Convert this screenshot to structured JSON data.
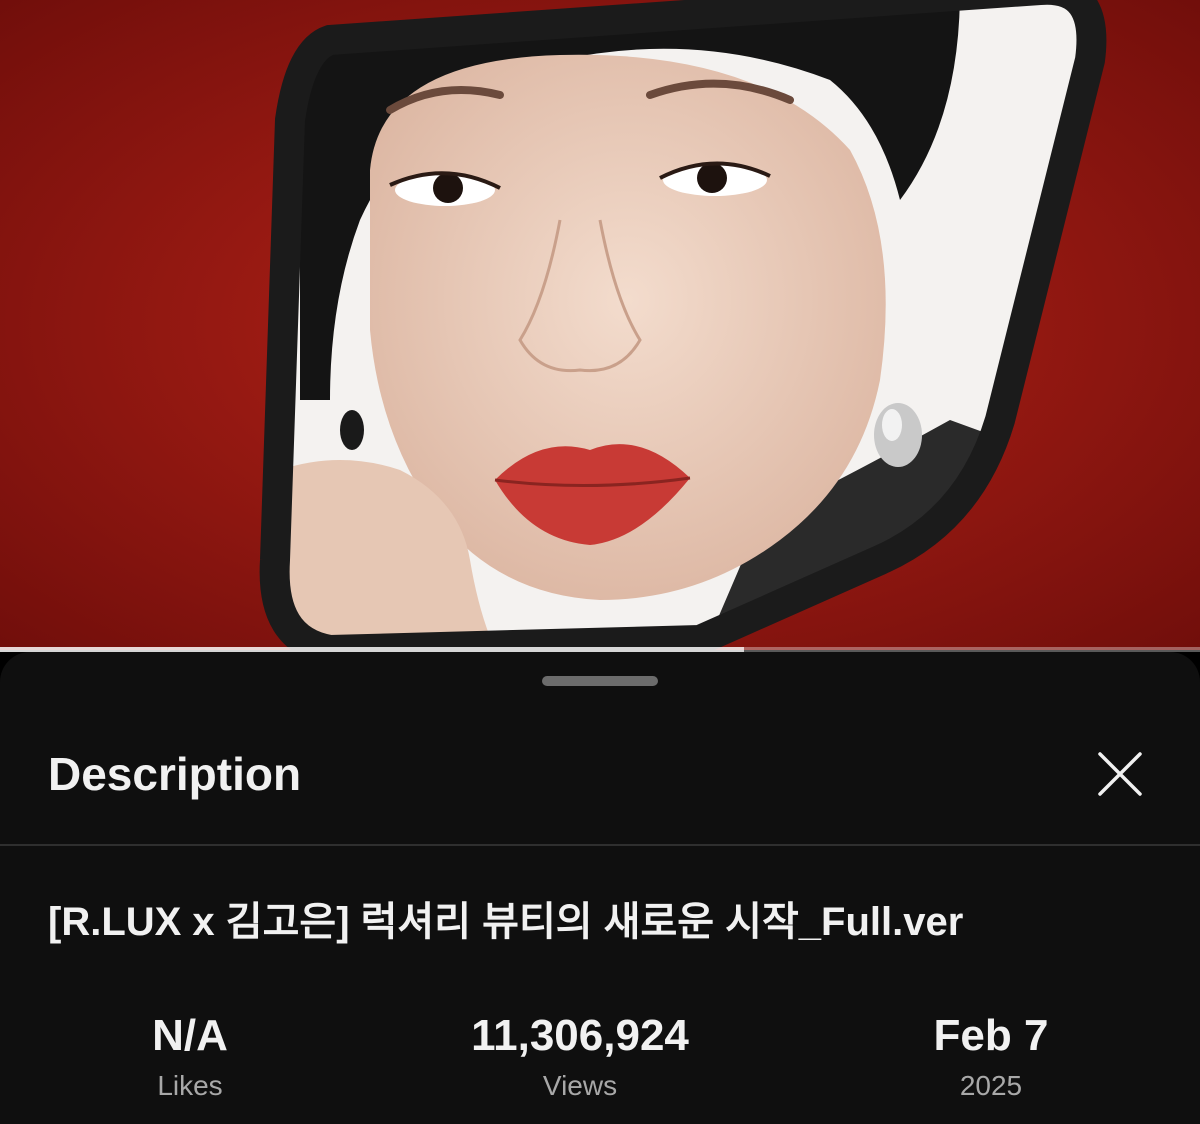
{
  "player": {
    "progress_fraction": 0.62
  },
  "description_sheet": {
    "title": "Description",
    "close_icon": "close-icon",
    "video_title": "[R.LUX x 김고은] 럭셔리 뷰티의 새로운 시작_Full.ver",
    "stats": [
      {
        "value": "N/A",
        "label": "Likes"
      },
      {
        "value": "11,306,924",
        "label": "Views"
      },
      {
        "value": "Feb 7",
        "label": "2025"
      }
    ]
  },
  "colors": {
    "sheet_background": "#0f0f0f",
    "video_background": "#8e1410",
    "text_primary": "#f1f1f1",
    "text_secondary": "#a8a8a8"
  }
}
